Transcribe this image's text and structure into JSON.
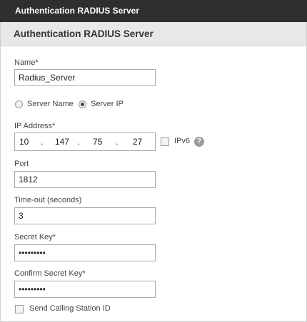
{
  "window": {
    "title": "Authentication RADIUS Server"
  },
  "panel": {
    "header": "Authentication RADIUS Server"
  },
  "form": {
    "name": {
      "label": "Name*",
      "value": "Radius_Server"
    },
    "server_type": {
      "options": [
        "Server Name",
        "Server IP"
      ],
      "selected": "Server IP"
    },
    "ip_address": {
      "label": "IP Address*",
      "octets": [
        "10",
        "147",
        "75",
        "27"
      ],
      "separator": "."
    },
    "ipv6": {
      "label": "IPv6",
      "checked": false,
      "help_icon": "question-circle",
      "help_glyph": "?"
    },
    "port": {
      "label": "Port",
      "value": "1812"
    },
    "timeout": {
      "label": "Time-out (seconds)",
      "value": "3"
    },
    "secret_key": {
      "label": "Secret Key*",
      "value": "•••••••••"
    },
    "confirm_secret_key": {
      "label": "Confirm Secret Key*",
      "value": "•••••••••"
    },
    "send_calling_station_id": {
      "label": "Send Calling Station ID",
      "checked": false
    }
  },
  "colors": {
    "titlebar_bg": "#2f2f2f",
    "header_bg": "#e8e8e8",
    "help_icon": "#9b9b9b"
  }
}
